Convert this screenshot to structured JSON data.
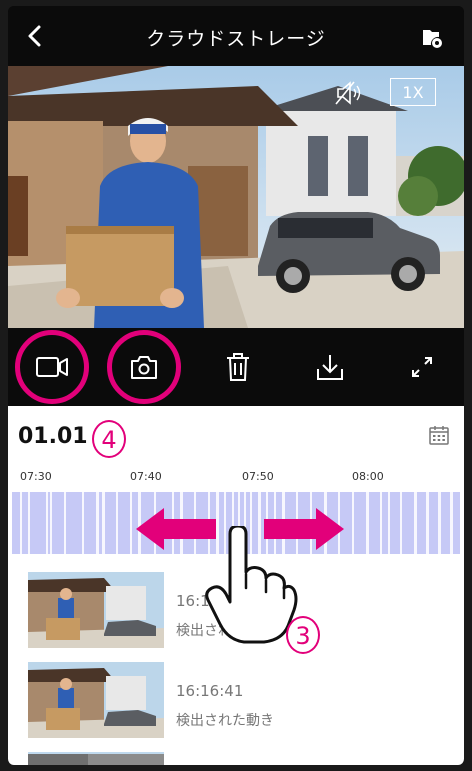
{
  "header": {
    "title": "クラウドストレージ",
    "back_icon": "chevron-left-icon",
    "right_icon": "cloud-settings-icon"
  },
  "video": {
    "zoom": "1X",
    "mute_icon": "speaker-muted-icon"
  },
  "toolbar": {
    "items": [
      {
        "icon": "video-record-icon",
        "highlighted": true
      },
      {
        "icon": "camera-snapshot-icon",
        "highlighted": true
      },
      {
        "icon": "trash-icon",
        "highlighted": false
      },
      {
        "icon": "download-icon",
        "highlighted": false
      },
      {
        "icon": "fullscreen-icon",
        "highlighted": false
      }
    ]
  },
  "panel": {
    "date": "01.01",
    "badge_date": "4",
    "badge_timeline": "3",
    "ticks": [
      "07:30",
      "07:40",
      "07:50",
      "08:00"
    ],
    "records": [
      {
        "time": "16:17:0",
        "label": "検出された動き"
      },
      {
        "time": "16:16:41",
        "label": "検出された動き"
      }
    ]
  },
  "colors": {
    "accent": "#e2007a",
    "timeline": "#c6c9f6",
    "background": "#0b0b0b"
  }
}
